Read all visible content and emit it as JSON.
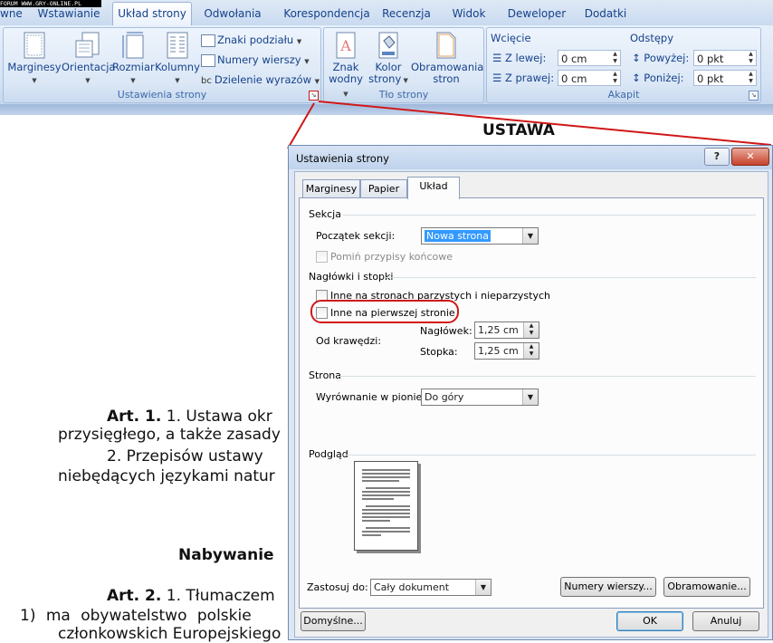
{
  "watermark": "FORUM WWW.GRY-ONLINE.PL",
  "ribbon": {
    "tabs": [
      "wne",
      "Wstawianie",
      "Układ strony",
      "Odwołania",
      "Korespondencja",
      "Recenzja",
      "Widok",
      "Deweloper",
      "Dodatki"
    ],
    "active_tab": "Układ strony",
    "groups": {
      "page_setup": {
        "label": "Ustawienia strony",
        "buttons": [
          "Marginesy",
          "Orientacja",
          "Rozmiar",
          "Kolumny"
        ],
        "small": [
          "Znaki podziału",
          "Numery wierszy",
          "Dzielenie wyrazów"
        ],
        "bc_glyph": "bc"
      },
      "background": {
        "label": "Tło strony",
        "buttons": [
          {
            "line1": "Znak",
            "line2": "wodny"
          },
          {
            "line1": "Kolor",
            "line2": "strony"
          },
          {
            "line1": "Obramowania",
            "line2": "stron"
          }
        ]
      },
      "paragraph": {
        "label": "Akapit",
        "indent_title": "Wcięcie",
        "left_label": "Z lewej:",
        "left_value": "0 cm",
        "right_label": "Z prawej:",
        "right_value": "0 cm",
        "spacing_title": "Odstępy",
        "before_label": "Powyżej:",
        "before_value": "0 pkt",
        "after_label": "Poniżej:",
        "after_value": "0 pkt"
      }
    }
  },
  "document": {
    "title": "USTAWA",
    "art1_bold": "Art. 1.",
    "art1_rest": "1. Ustawa okr",
    "line2": "przysięgłego, a także zasady",
    "line3": "2. Przepisów ustawy",
    "line4": "niebędących językami natur",
    "heading": "Nabywanie",
    "art2_bold": "Art. 2.",
    "art2_rest": "1. Tłumaczem",
    "line6": "1) ma obywatelstwo polskie",
    "line7": "członkowskich Europejskiego"
  },
  "dialog": {
    "title": "Ustawienia strony",
    "help": "?",
    "close": "✕",
    "tabs": [
      "Marginesy",
      "Papier",
      "Układ"
    ],
    "active_tab": "Układ",
    "section1": "Sekcja",
    "section_start_label": "Początek sekcji:",
    "section_start_value": "Nowa strona",
    "suppress_endnotes": "Pomiń przypisy końcowe",
    "section2": "Nagłówki i stopki",
    "diff_odd_even": "Inne na stronach parzystych i nieparzystych",
    "diff_first": "Inne na pierwszej stronie",
    "from_edge": "Od krawędzi:",
    "header_label": "Nagłówek:",
    "header_value": "1,25 cm",
    "footer_label": "Stopka:",
    "footer_value": "1,25 cm",
    "section3": "Strona",
    "valign_label": "Wyrównanie w pionie:",
    "valign_value": "Do góry",
    "preview": "Podgląd",
    "apply_label": "Zastosuj do:",
    "apply_value": "Cały dokument",
    "line_numbers_btn": "Numery wierszy...",
    "borders_btn": "Obramowanie...",
    "default_btn": "Domyślne...",
    "ok_btn": "OK",
    "cancel_btn": "Anuluj"
  },
  "colors": {
    "annotation": "#d01818",
    "ribbon_text": "#15428b",
    "selection": "#3399ff"
  }
}
